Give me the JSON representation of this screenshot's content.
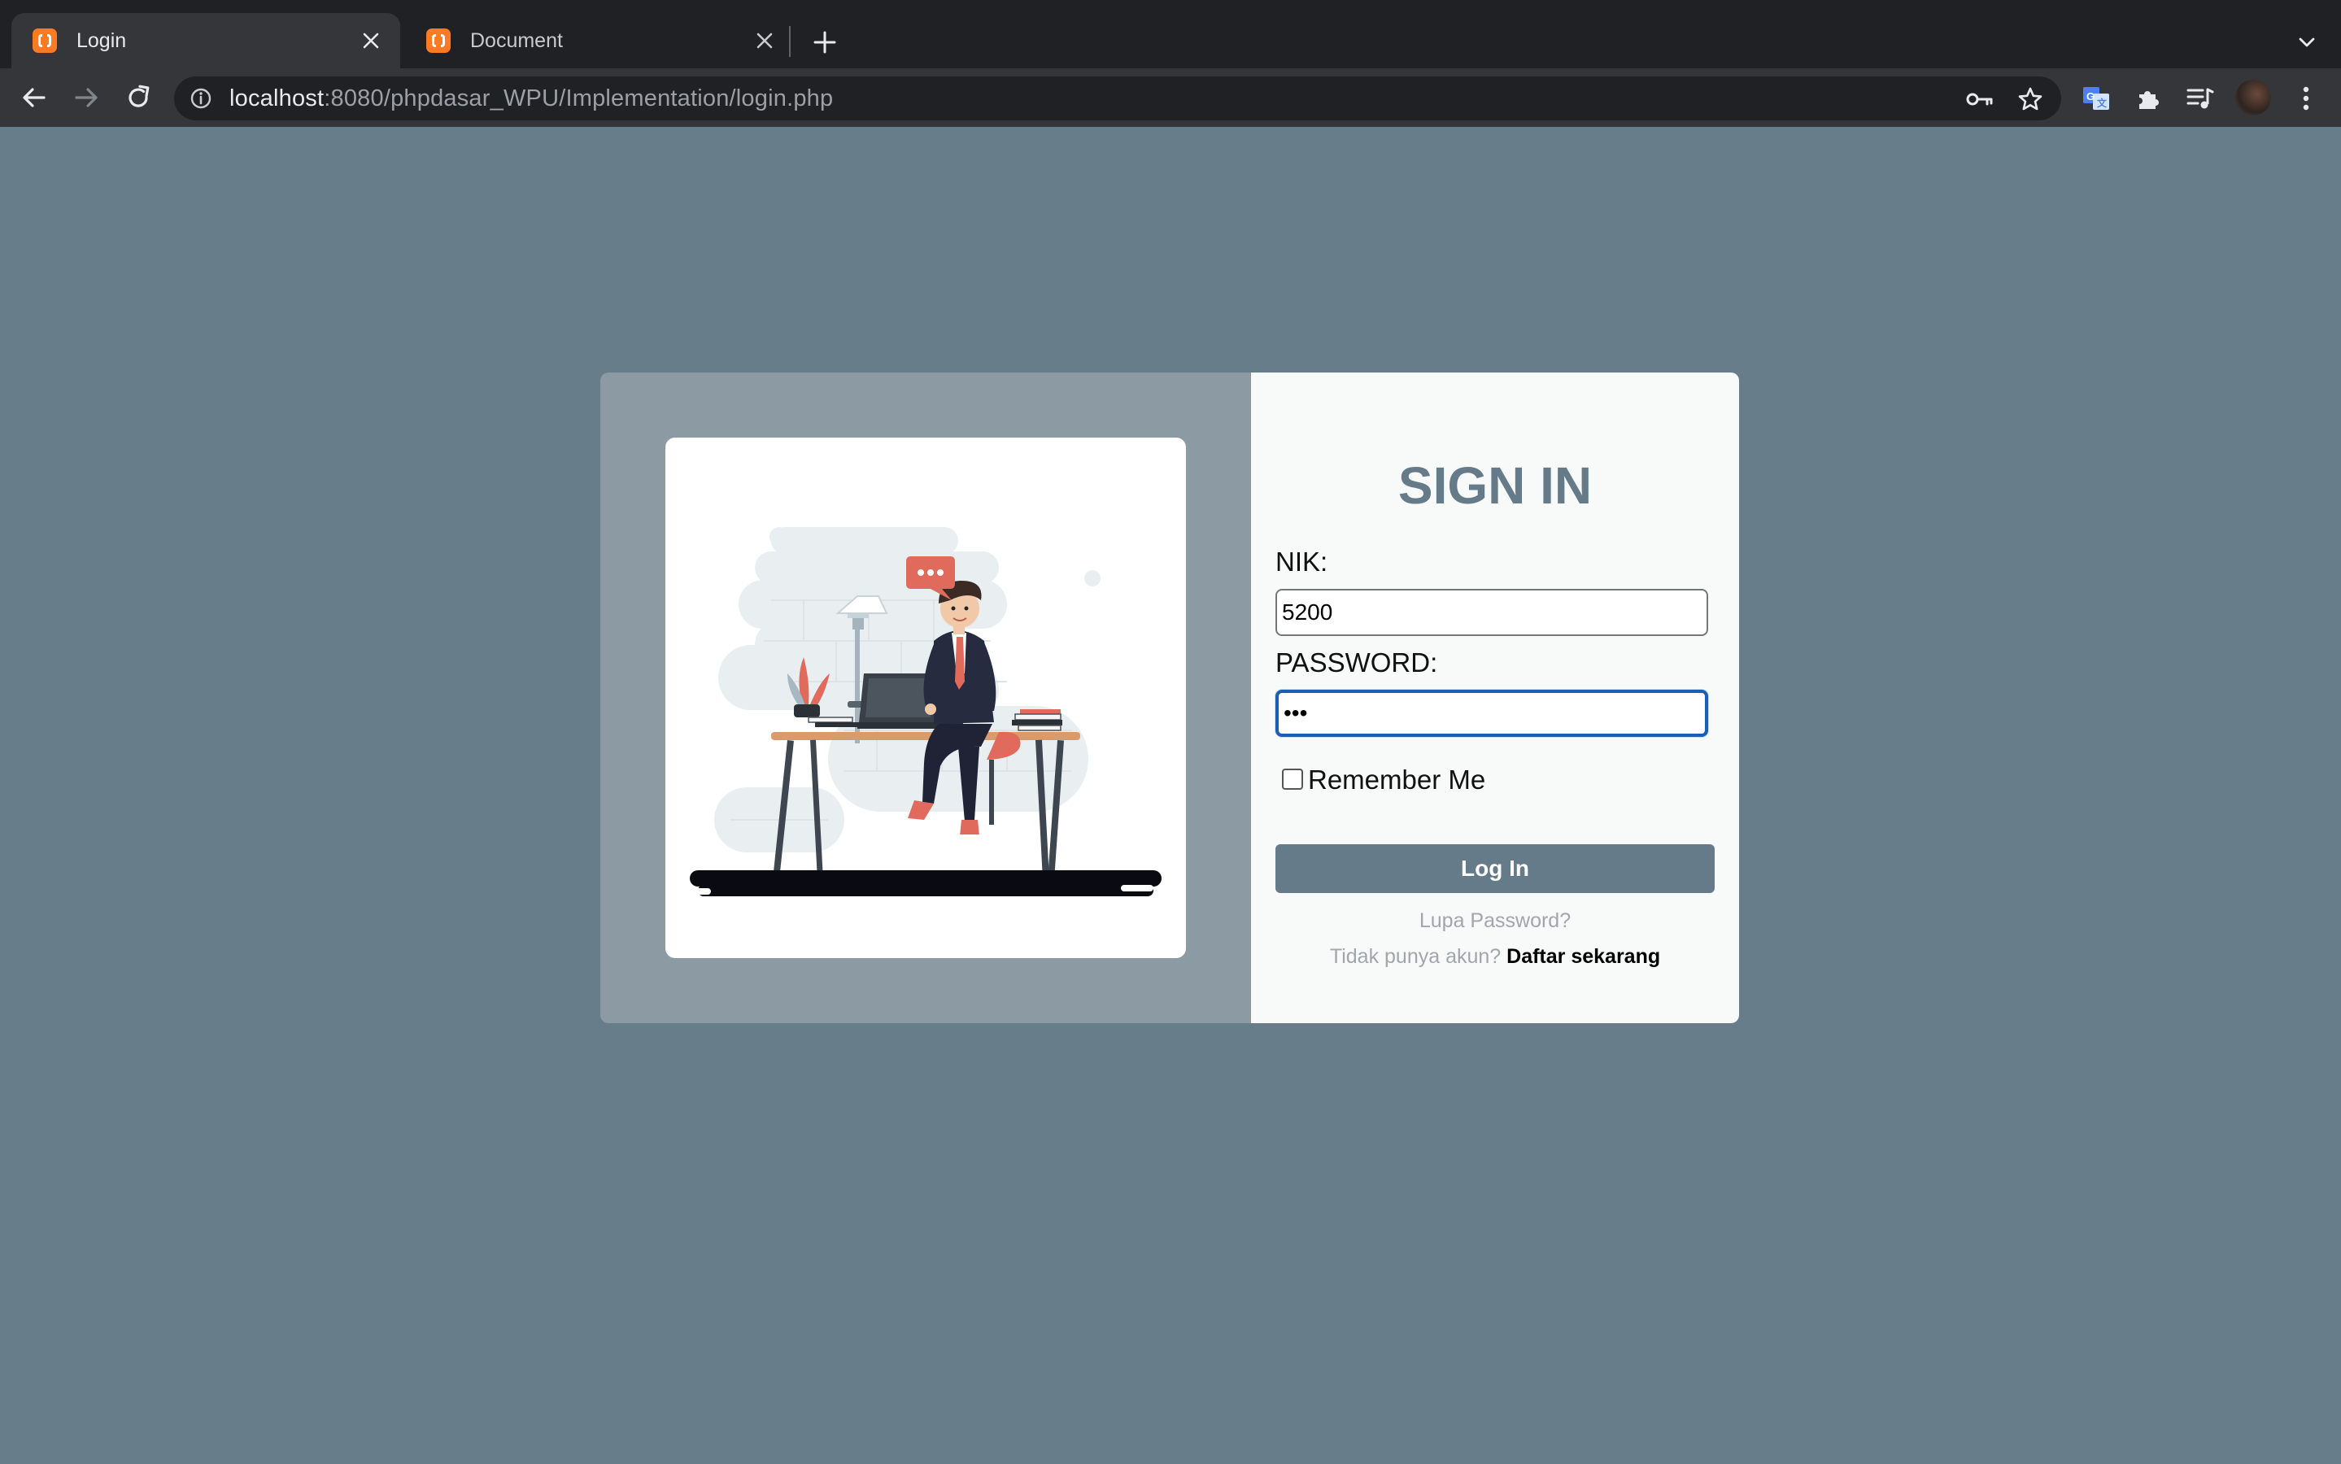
{
  "browser": {
    "tabs": [
      {
        "title": "Login",
        "active": true
      },
      {
        "title": "Document",
        "active": false
      }
    ],
    "url": {
      "host": "localhost",
      "path": ":8080/phpdasar_WPU/Implementation/login.php"
    }
  },
  "colors": {
    "page_background": "#687d8a",
    "accent": "#667b89",
    "focus_ring": "#1a5fb4"
  },
  "login": {
    "title": "SIGN IN",
    "nik_label": "NIK:",
    "nik_value": "5200",
    "password_label": "PASSWORD:",
    "password_value": "abc",
    "remember_label": "Remember Me",
    "remember_checked": false,
    "submit_label": "Log In",
    "forgot_label": "Lupa Password?",
    "signup_prompt": "Tidak punya akun?",
    "signup_link": "Daftar sekarang"
  },
  "icons": [
    "back-arrow-icon",
    "forward-arrow-icon",
    "reload-icon",
    "info-icon",
    "key-icon",
    "star-icon",
    "translate-icon",
    "puzzle-icon",
    "media-queue-icon",
    "kebab-menu-icon",
    "close-icon",
    "plus-icon",
    "chevron-down-icon"
  ]
}
